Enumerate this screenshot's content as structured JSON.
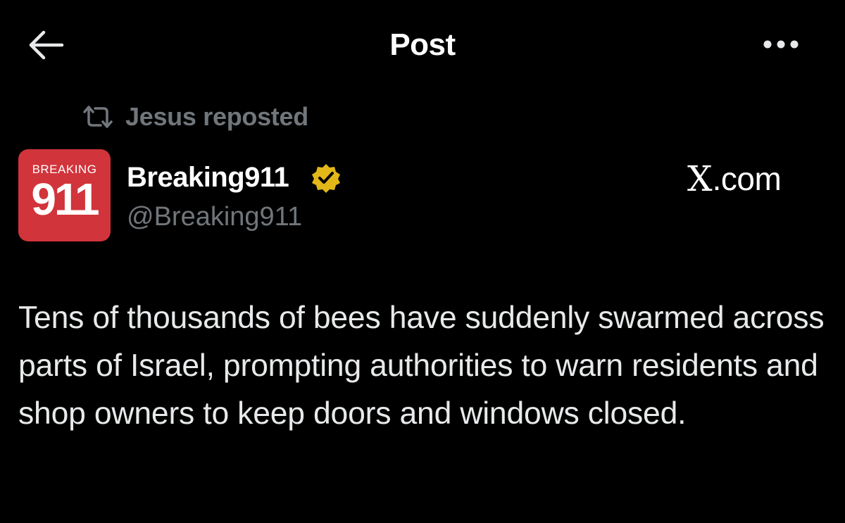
{
  "header": {
    "back_icon": "arrow-left-icon",
    "title": "Post",
    "more_icon": "more-horizontal-icon"
  },
  "repost": {
    "icon": "repost-icon",
    "text": "Jesus reposted"
  },
  "author": {
    "avatar_text_top": "BREAKING",
    "avatar_text_main": "911",
    "avatar_color": "#d1343b",
    "display_name": "Breaking911",
    "verified_icon": "verified-badge-icon",
    "verified_color": "#e2b719",
    "handle": "@Breaking911"
  },
  "watermark": {
    "logo": "X",
    "suffix": ".com"
  },
  "post": {
    "text": "Tens of thousands of bees have suddenly swarmed across parts of Israel, prompting authorities to warn residents and shop owners to keep doors and windows closed."
  },
  "colors": {
    "background": "#000000",
    "primary_text": "#e7e9ea",
    "secondary_text": "#71767b"
  }
}
